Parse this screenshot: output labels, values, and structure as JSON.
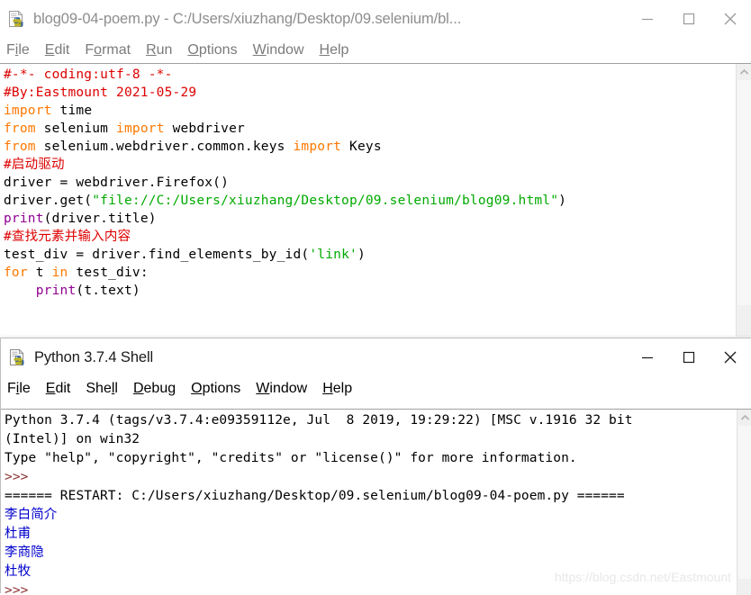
{
  "editor_window": {
    "icon": "python-idle-icon",
    "title": "blog09-04-poem.py - C:/Users/xiuzhang/Desktop/09.selenium/bl...",
    "active": false,
    "controls": {
      "minimize": "minimize-icon",
      "maximize": "maximize-icon",
      "close": "close-icon"
    },
    "menu": [
      {
        "pre": "F",
        "key": "i",
        "post": "le"
      },
      {
        "pre": "",
        "key": "E",
        "post": "dit"
      },
      {
        "pre": "F",
        "key": "o",
        "post": "rmat"
      },
      {
        "pre": "",
        "key": "R",
        "post": "un"
      },
      {
        "pre": "",
        "key": "O",
        "post": "ptions"
      },
      {
        "pre": "",
        "key": "W",
        "post": "indow"
      },
      {
        "pre": "",
        "key": "H",
        "post": "elp"
      }
    ],
    "code_lines": [
      [
        {
          "t": "#-*- coding:utf-8 -*-",
          "c": "c-comment"
        }
      ],
      [
        {
          "t": "#By:Eastmount 2021-05-29",
          "c": "c-comment"
        }
      ],
      [
        {
          "t": "import",
          "c": "c-keyword"
        },
        {
          "t": " time",
          "c": "c-plain"
        }
      ],
      [
        {
          "t": "from",
          "c": "c-keyword"
        },
        {
          "t": " selenium ",
          "c": "c-plain"
        },
        {
          "t": "import",
          "c": "c-keyword"
        },
        {
          "t": " webdriver",
          "c": "c-plain"
        }
      ],
      [
        {
          "t": "from",
          "c": "c-keyword"
        },
        {
          "t": " selenium.webdriver.common.keys ",
          "c": "c-plain"
        },
        {
          "t": "import",
          "c": "c-keyword"
        },
        {
          "t": " Keys",
          "c": "c-plain"
        }
      ],
      [
        {
          "t": "",
          "c": "c-plain"
        }
      ],
      [
        {
          "t": "#启动驱动",
          "c": "c-comment"
        }
      ],
      [
        {
          "t": "driver = webdriver.Firefox()",
          "c": "c-plain"
        }
      ],
      [
        {
          "t": "driver.get(",
          "c": "c-plain"
        },
        {
          "t": "\"file://C:/Users/xiuzhang/Desktop/09.selenium/blog09.html\"",
          "c": "c-string"
        },
        {
          "t": ")",
          "c": "c-plain"
        }
      ],
      [
        {
          "t": "print",
          "c": "c-builtin"
        },
        {
          "t": "(driver.title)",
          "c": "c-plain"
        }
      ],
      [
        {
          "t": "",
          "c": "c-plain"
        }
      ],
      [
        {
          "t": "#查找元素并输入内容",
          "c": "c-comment"
        }
      ],
      [
        {
          "t": "test_div = driver.find_elements_by_id(",
          "c": "c-plain"
        },
        {
          "t": "'link'",
          "c": "c-string"
        },
        {
          "t": ")",
          "c": "c-plain"
        }
      ],
      [
        {
          "t": "for",
          "c": "c-keyword"
        },
        {
          "t": " t ",
          "c": "c-plain"
        },
        {
          "t": "in",
          "c": "c-keyword"
        },
        {
          "t": " test_div:",
          "c": "c-plain"
        }
      ],
      [
        {
          "t": "    ",
          "c": "c-plain"
        },
        {
          "t": "print",
          "c": "c-builtin"
        },
        {
          "t": "(t.text)",
          "c": "c-plain"
        }
      ]
    ],
    "scrollbar": {
      "up_arrow": "chevron-up-icon",
      "down_arrow": "chevron-down-icon"
    }
  },
  "shell_window": {
    "icon": "python-idle-icon",
    "title": "Python 3.7.4 Shell",
    "active": true,
    "controls": {
      "minimize": "minimize-icon",
      "maximize": "maximize-icon",
      "close": "close-icon"
    },
    "menu": [
      {
        "pre": "F",
        "key": "i",
        "post": "le"
      },
      {
        "pre": "",
        "key": "E",
        "post": "dit"
      },
      {
        "pre": "She",
        "key": "l",
        "post": "l"
      },
      {
        "pre": "",
        "key": "D",
        "post": "ebug"
      },
      {
        "pre": "",
        "key": "O",
        "post": "ptions"
      },
      {
        "pre": "",
        "key": "W",
        "post": "indow"
      },
      {
        "pre": "",
        "key": "H",
        "post": "elp"
      }
    ],
    "output_lines": [
      [
        {
          "t": "Python 3.7.4 (tags/v3.7.4:e09359112e, Jul  8 2019, 19:29:22) [MSC v.1916 32 bit",
          "c": "c-plain"
        }
      ],
      [
        {
          "t": "(Intel)] on win32",
          "c": "c-plain"
        }
      ],
      [
        {
          "t": "Type \"help\", \"copyright\", \"credits\" or \"license()\" for more information.",
          "c": "c-plain"
        }
      ],
      [
        {
          "t": ">>> ",
          "c": "c-prompt"
        }
      ],
      [
        {
          "t": "====== RESTART: C:/Users/xiuzhang/Desktop/09.selenium/blog09-04-poem.py ======",
          "c": "c-plain"
        }
      ],
      [
        {
          "t": "李白简介",
          "c": "c-stdout cjk"
        }
      ],
      [
        {
          "t": "杜甫",
          "c": "c-stdout cjk"
        }
      ],
      [
        {
          "t": "李商隐",
          "c": "c-stdout cjk"
        }
      ],
      [
        {
          "t": "杜牧",
          "c": "c-stdout cjk"
        }
      ],
      [
        {
          "t": ">>> ",
          "c": "c-prompt"
        }
      ]
    ],
    "scrollbar": {
      "up_arrow": "chevron-up-icon",
      "down_arrow": "chevron-down-icon"
    }
  },
  "watermark": "https://blog.csdn.net/Eastmount",
  "colors": {
    "comment": "#dd0000",
    "keyword": "#ff7700",
    "string": "#00aa00",
    "builtin": "#900090",
    "stdout": "#0000cc",
    "prompt": "#8b3030",
    "title_inactive": "#8d8d8d",
    "title_active": "#1a1a1a"
  }
}
